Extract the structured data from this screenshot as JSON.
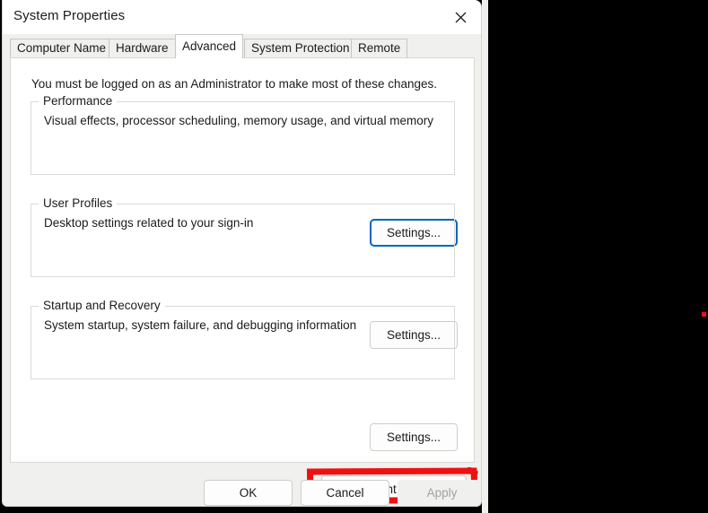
{
  "window": {
    "title": "System Properties",
    "close_icon": "close-icon"
  },
  "tabs": [
    {
      "label": "Computer Name",
      "selected": false
    },
    {
      "label": "Hardware",
      "selected": false
    },
    {
      "label": "Advanced",
      "selected": true
    },
    {
      "label": "System Protection",
      "selected": false
    },
    {
      "label": "Remote",
      "selected": false
    }
  ],
  "page": {
    "admin_note": "You must be logged on as an Administrator to make most of these changes.",
    "groups": [
      {
        "legend": "Performance",
        "description": "Visual effects, processor scheduling, memory usage, and virtual memory",
        "button_label": "Settings...",
        "button_focused": true
      },
      {
        "legend": "User Profiles",
        "description": "Desktop settings related to your sign-in",
        "button_label": "Settings...",
        "button_focused": false
      },
      {
        "legend": "Startup and Recovery",
        "description": "System startup, system failure, and debugging information",
        "button_label": "Settings...",
        "button_focused": false
      }
    ],
    "environment_variables_label": "Environment Variables..."
  },
  "annotation": {
    "shape": "red-rectangle-highlight",
    "target": "Environment Variables...",
    "color": "#ee1111"
  },
  "footer": {
    "ok_label": "OK",
    "cancel_label": "Cancel",
    "apply_label": "Apply",
    "apply_disabled": true
  },
  "desktop": {
    "background_color": "#000000",
    "marker_color": "#e81123"
  }
}
